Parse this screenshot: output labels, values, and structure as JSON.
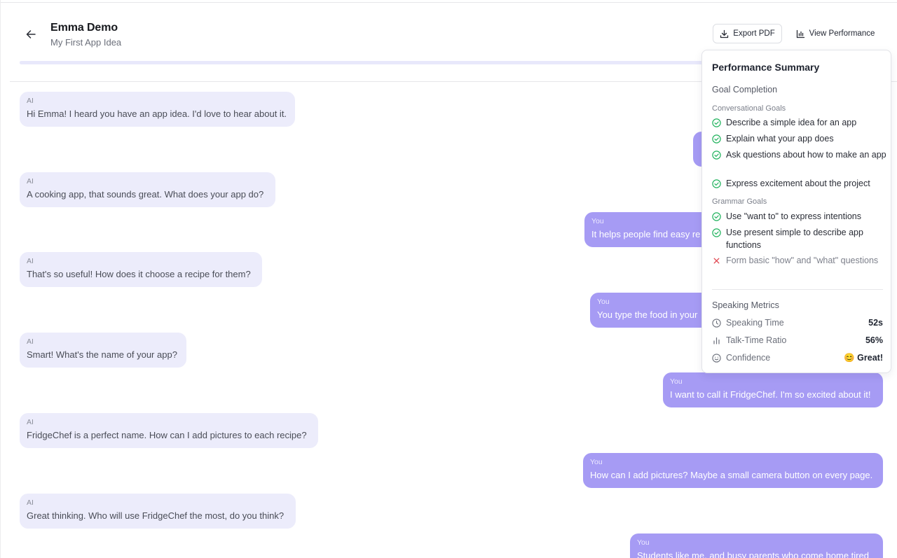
{
  "header": {
    "title": "Emma Demo",
    "subtitle": "My First App Idea",
    "export_label": "Export PDF",
    "performance_label": "View Performance"
  },
  "progress": {
    "fraction": 1.0
  },
  "conversation": {
    "ai_1": {
      "who": "AI",
      "text": "Hi Emma! I heard you have an app idea. I'd love to hear about it."
    },
    "you_1": {
      "who": "You",
      "text": ""
    },
    "ai_2": {
      "who": "AI",
      "text": "A cooking app, that sounds great. What does your app do?"
    },
    "you_2": {
      "who": "You",
      "text": "It helps people find easy re"
    },
    "ai_3": {
      "who": "AI",
      "text": "That's so useful! How does it choose a recipe for them?"
    },
    "you_3": {
      "who": "You",
      "text": "You type the food in your"
    },
    "ai_4": {
      "who": "AI",
      "text": "Smart! What's the name of your app?"
    },
    "you_4": {
      "who": "You",
      "text": "I want to call it FridgeChef. I'm so excited about it!"
    },
    "ai_5": {
      "who": "AI",
      "text": "FridgeChef is a perfect name. How can I add pictures to each recipe?"
    },
    "you_5": {
      "who": "You",
      "text": "How can I add pictures? Maybe a small camera button on every page."
    },
    "ai_6": {
      "who": "AI",
      "text": "Great thinking. Who will use FridgeChef the most, do you think?"
    },
    "you_6": {
      "who": "You",
      "text": "Students like me, and busy parents who come home tired"
    }
  },
  "performance": {
    "title": "Performance Summary",
    "goal_completion": "Goal Completion",
    "conversational_heading": "Conversational Goals",
    "conversational": [
      {
        "text": "Describe a simple idea for an app",
        "status": "done"
      },
      {
        "text": "Explain what your app does",
        "status": "done"
      },
      {
        "text": "Ask questions about how to make an app",
        "status": "done"
      },
      {
        "text": "Express excitement about the project",
        "status": "done"
      }
    ],
    "grammar_heading": "Grammar Goals",
    "grammar": [
      {
        "text": "Use \"want to\" to express intentions",
        "status": "done"
      },
      {
        "text": "Use present simple to describe app functions",
        "status": "done"
      },
      {
        "text": "Form basic \"how\" and \"what\" questions",
        "status": "failed"
      }
    ],
    "metrics_heading": "Speaking Metrics",
    "metrics": {
      "speaking_time": {
        "label": "Speaking Time",
        "value": "52s",
        "icon": "clock-icon"
      },
      "talk_ratio": {
        "label": "Talk-Time Ratio",
        "value": "56%",
        "icon": "bar-chart-icon"
      },
      "confidence": {
        "label": "Confidence",
        "value": "😊 Great!",
        "icon": "smile-icon"
      }
    }
  },
  "colors": {
    "ai_bubble": "#ececfb",
    "user_bubble": "#a69bf4",
    "success": "#22b35e",
    "fail": "#e0454f"
  }
}
